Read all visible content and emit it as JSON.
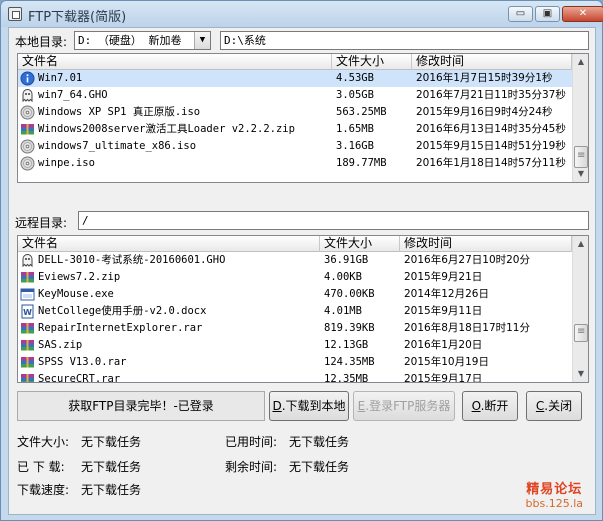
{
  "window": {
    "title": "FTP下载器(简版)",
    "min_glyph": "▭",
    "max_glyph": "▣",
    "close_glyph": "✕"
  },
  "local": {
    "label": "本地目录:",
    "drive_selected": "D: （硬盘） 新加卷",
    "path": "D:\\系统",
    "columns": [
      "文件名",
      "文件大小",
      "修改时间"
    ],
    "files": [
      {
        "name": "Win7.01",
        "size": "4.53GB",
        "mtime": "2016年1月7日15时39分1秒",
        "icon": "info-icon",
        "selected": true
      },
      {
        "name": "win7_64.GHO",
        "size": "3.05GB",
        "mtime": "2016年7月21日11时35分37秒",
        "icon": "ghost-icon",
        "selected": false
      },
      {
        "name": "Windows XP SP1 真正原版.iso",
        "size": "563.25MB",
        "mtime": "2015年9月16日9时4分24秒",
        "icon": "disc-icon",
        "selected": false
      },
      {
        "name": "Windows2008server激活工具Loader v2.2.2.zip",
        "size": "1.65MB",
        "mtime": "2016年6月13日14时35分45秒",
        "icon": "archive-icon",
        "selected": false
      },
      {
        "name": "windows7_ultimate_x86.iso",
        "size": "3.16GB",
        "mtime": "2015年9月15日14时51分19秒",
        "icon": "disc-icon",
        "selected": false
      },
      {
        "name": "winpe.iso",
        "size": "189.77MB",
        "mtime": "2016年1月18日14时57分11秒",
        "icon": "disc-icon",
        "selected": false
      }
    ]
  },
  "remote": {
    "label": "远程目录:",
    "path": "/",
    "columns": [
      "文件名",
      "文件大小",
      "修改时间"
    ],
    "files": [
      {
        "name": "DELL-3010-考试系统-20160601.GHO",
        "size": "36.91GB",
        "mtime": "2016年6月27日10时20分",
        "icon": "ghost-icon"
      },
      {
        "name": "Eviews7.2.zip",
        "size": "4.00KB",
        "mtime": "2015年9月21日",
        "icon": "archive-icon"
      },
      {
        "name": "KeyMouse.exe",
        "size": "470.00KB",
        "mtime": "2014年12月26日",
        "icon": "exe-icon"
      },
      {
        "name": "NetCollege使用手册-v2.0.docx",
        "size": "4.01MB",
        "mtime": "2015年9月11日",
        "icon": "doc-icon"
      },
      {
        "name": "RepairInternetExplorer.rar",
        "size": "819.39KB",
        "mtime": "2016年8月18日17时11分",
        "icon": "archive-icon"
      },
      {
        "name": "SAS.zip",
        "size": "12.13GB",
        "mtime": "2016年1月20日",
        "icon": "archive-icon"
      },
      {
        "name": "SPSS V13.0.rar",
        "size": "124.35MB",
        "mtime": "2015年10月19日",
        "icon": "archive-icon"
      },
      {
        "name": "SecureCRT.rar",
        "size": "12.35MB",
        "mtime": "2015年9月17日",
        "icon": "archive-icon"
      }
    ]
  },
  "status": {
    "message": "获取FTP目录完毕！-已登录"
  },
  "buttons": {
    "download": {
      "key": "D",
      "label": ".下载到本地"
    },
    "login": {
      "key": "E",
      "label": ".登录FTP服务器"
    },
    "disconnect": {
      "key": "O",
      "label": ".断开"
    },
    "close": {
      "key": "C",
      "label": ".关闭"
    }
  },
  "info": {
    "file_size_label": "文件大小:",
    "file_size_value": "无下载任务",
    "downloaded_label": "已 下 载:",
    "downloaded_value": "无下载任务",
    "speed_label": "下载速度:",
    "speed_value": "无下载任务",
    "elapsed_label": "已用时间:",
    "elapsed_value": "无下载任务",
    "remaining_label": "剩余时间:",
    "remaining_value": "无下载任务"
  },
  "watermark": {
    "line1": "精易论坛",
    "line2": "bbs.125.la"
  },
  "colors": {
    "selection": "#cfe3fb",
    "accent": "#e0431f"
  }
}
